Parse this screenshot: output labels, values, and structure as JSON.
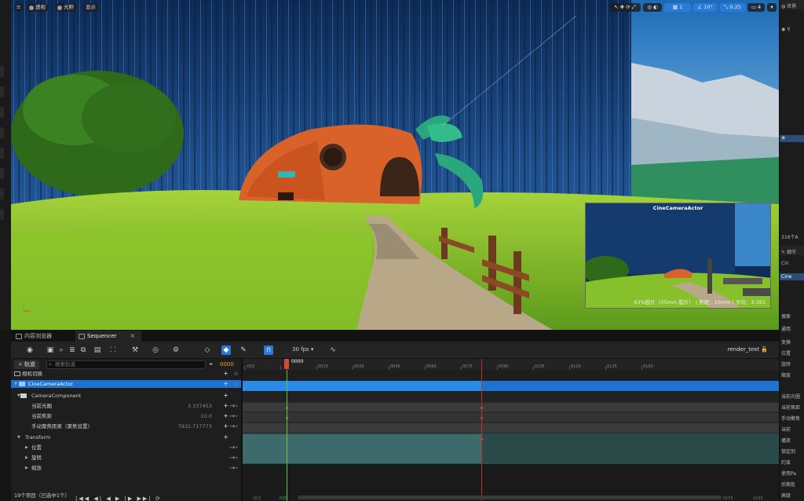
{
  "viewport": {
    "top_left_buttons": [
      {
        "label": "透视",
        "name": "perspective-button"
      },
      {
        "label": "光照",
        "name": "lit-button"
      },
      {
        "label": "显示",
        "name": "show-button"
      }
    ],
    "top_right": {
      "grid_value": "1",
      "angle_value": "10°",
      "scale_value": "0.25",
      "camera_speed": "4"
    },
    "pip": {
      "title": "CineCameraActor",
      "info": "63%胶片（35mm 胶片） | 焦距：10mm | 平均：3.381"
    }
  },
  "tabs": [
    {
      "label": "内容浏览器",
      "active": false
    },
    {
      "label": "Sequencer",
      "active": true
    }
  ],
  "toolbar": {
    "fps": "30 fps",
    "sequence_name": "render_text"
  },
  "tree": {
    "add_track": "轨道",
    "search_placeholder": "搜索轨道",
    "current_frame": "0000",
    "rows": [
      {
        "label": "相机切换",
        "indent": 14,
        "value": "",
        "selected": false,
        "kind": "track"
      },
      {
        "label": "CineCameraActor",
        "indent": 14,
        "value": "",
        "selected": true,
        "kind": "actor"
      },
      {
        "label": "CameraComponent",
        "indent": 18,
        "value": "",
        "selected": false,
        "kind": "component"
      },
      {
        "label": "当前光圈",
        "indent": 26,
        "value": "3.337453",
        "selected": false,
        "kind": "property"
      },
      {
        "label": "当前焦距",
        "indent": 26,
        "value": "10.0",
        "selected": false,
        "kind": "property"
      },
      {
        "label": "手动聚焦距离（聚焦设置）",
        "indent": 26,
        "value": "7932.717773",
        "selected": false,
        "kind": "property"
      },
      {
        "label": "Transform",
        "indent": 18,
        "value": "",
        "selected": false,
        "kind": "transform"
      },
      {
        "label": "位置",
        "indent": 26,
        "value": "",
        "selected": false,
        "kind": "subtrack"
      },
      {
        "label": "旋转",
        "indent": 26,
        "value": "",
        "selected": false,
        "kind": "subtrack"
      },
      {
        "label": "缩放",
        "indent": 26,
        "value": "",
        "selected": false,
        "kind": "subtrack"
      }
    ],
    "footer": "19个项目（已选中1个）"
  },
  "timeline": {
    "playhead": "0000",
    "ticks": [
      "-015",
      "0000",
      "0015",
      "0030",
      "0045",
      "0060",
      "0075",
      "0090",
      "0105",
      "0120",
      "0135",
      "0150"
    ],
    "bottom_ticks": [
      "-015",
      "-005",
      "0155",
      "0165"
    ]
  },
  "right_panel": {
    "title": "世界",
    "count": "316个A",
    "details_title": "细节",
    "rows": [
      "Cin",
      "Cine",
      "搜索",
      "通用",
      "变换",
      "位置",
      "旋转",
      "缩放",
      "当前光圈",
      "当前焦距",
      "手动聚焦",
      "当前",
      "播放",
      "锁定到",
      "约束",
      "使用Pa",
      "后期处",
      "高级"
    ]
  },
  "colors": {
    "accent": "#1f73d0",
    "playhead": "#d0493a",
    "green": "#5fc24a"
  }
}
